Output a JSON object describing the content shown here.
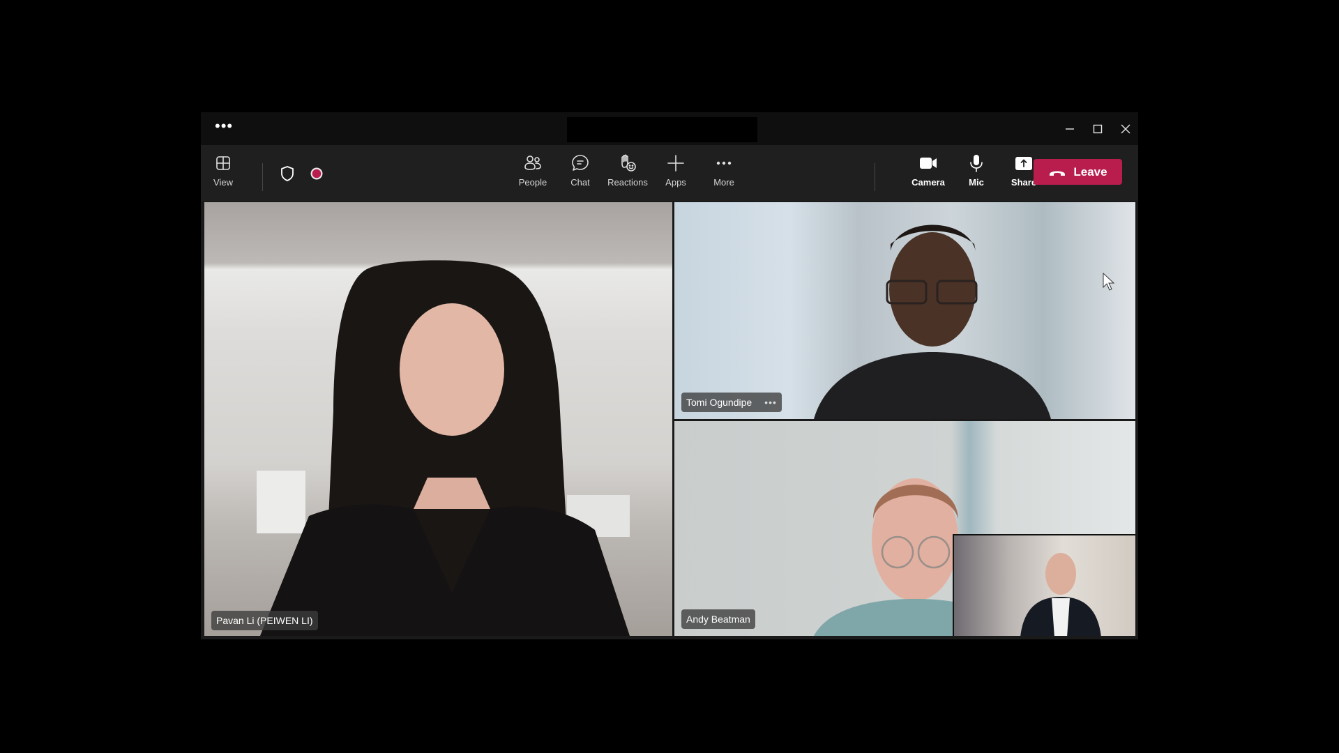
{
  "window": {
    "title_menu": "•••",
    "controls": {
      "minimize": "minimize",
      "maximize": "maximize",
      "close": "close"
    }
  },
  "toolbar": {
    "view_label": "View",
    "left_icons": [
      "shield-icon",
      "recording-indicator"
    ],
    "buttons": [
      {
        "id": "people",
        "label": "People",
        "icon": "people-icon"
      },
      {
        "id": "chat",
        "label": "Chat",
        "icon": "chat-icon"
      },
      {
        "id": "reactions",
        "label": "Reactions",
        "icon": "reactions-icon"
      },
      {
        "id": "apps",
        "label": "Apps",
        "icon": "plus-icon"
      },
      {
        "id": "more",
        "label": "More",
        "icon": "more-icon"
      }
    ],
    "media_buttons": [
      {
        "id": "camera",
        "label": "Camera",
        "icon": "camera-icon"
      },
      {
        "id": "mic",
        "label": "Mic",
        "icon": "mic-icon"
      },
      {
        "id": "share",
        "label": "Share",
        "icon": "share-icon"
      }
    ],
    "leave_label": "Leave"
  },
  "colors": {
    "leave": "#b81d4e",
    "record": "#b81d4e",
    "titlebar": "#0f0f0f",
    "toolbar": "#1f1f1f"
  },
  "participants": [
    {
      "name": "Pavan Li (PEIWEN LI)",
      "has_more": false
    },
    {
      "name": "Tomi Ogundipe",
      "has_more": true,
      "more_label": "•••"
    },
    {
      "name": "Andy Beatman",
      "has_more": false
    }
  ],
  "self_view": {
    "label": "self-view"
  }
}
